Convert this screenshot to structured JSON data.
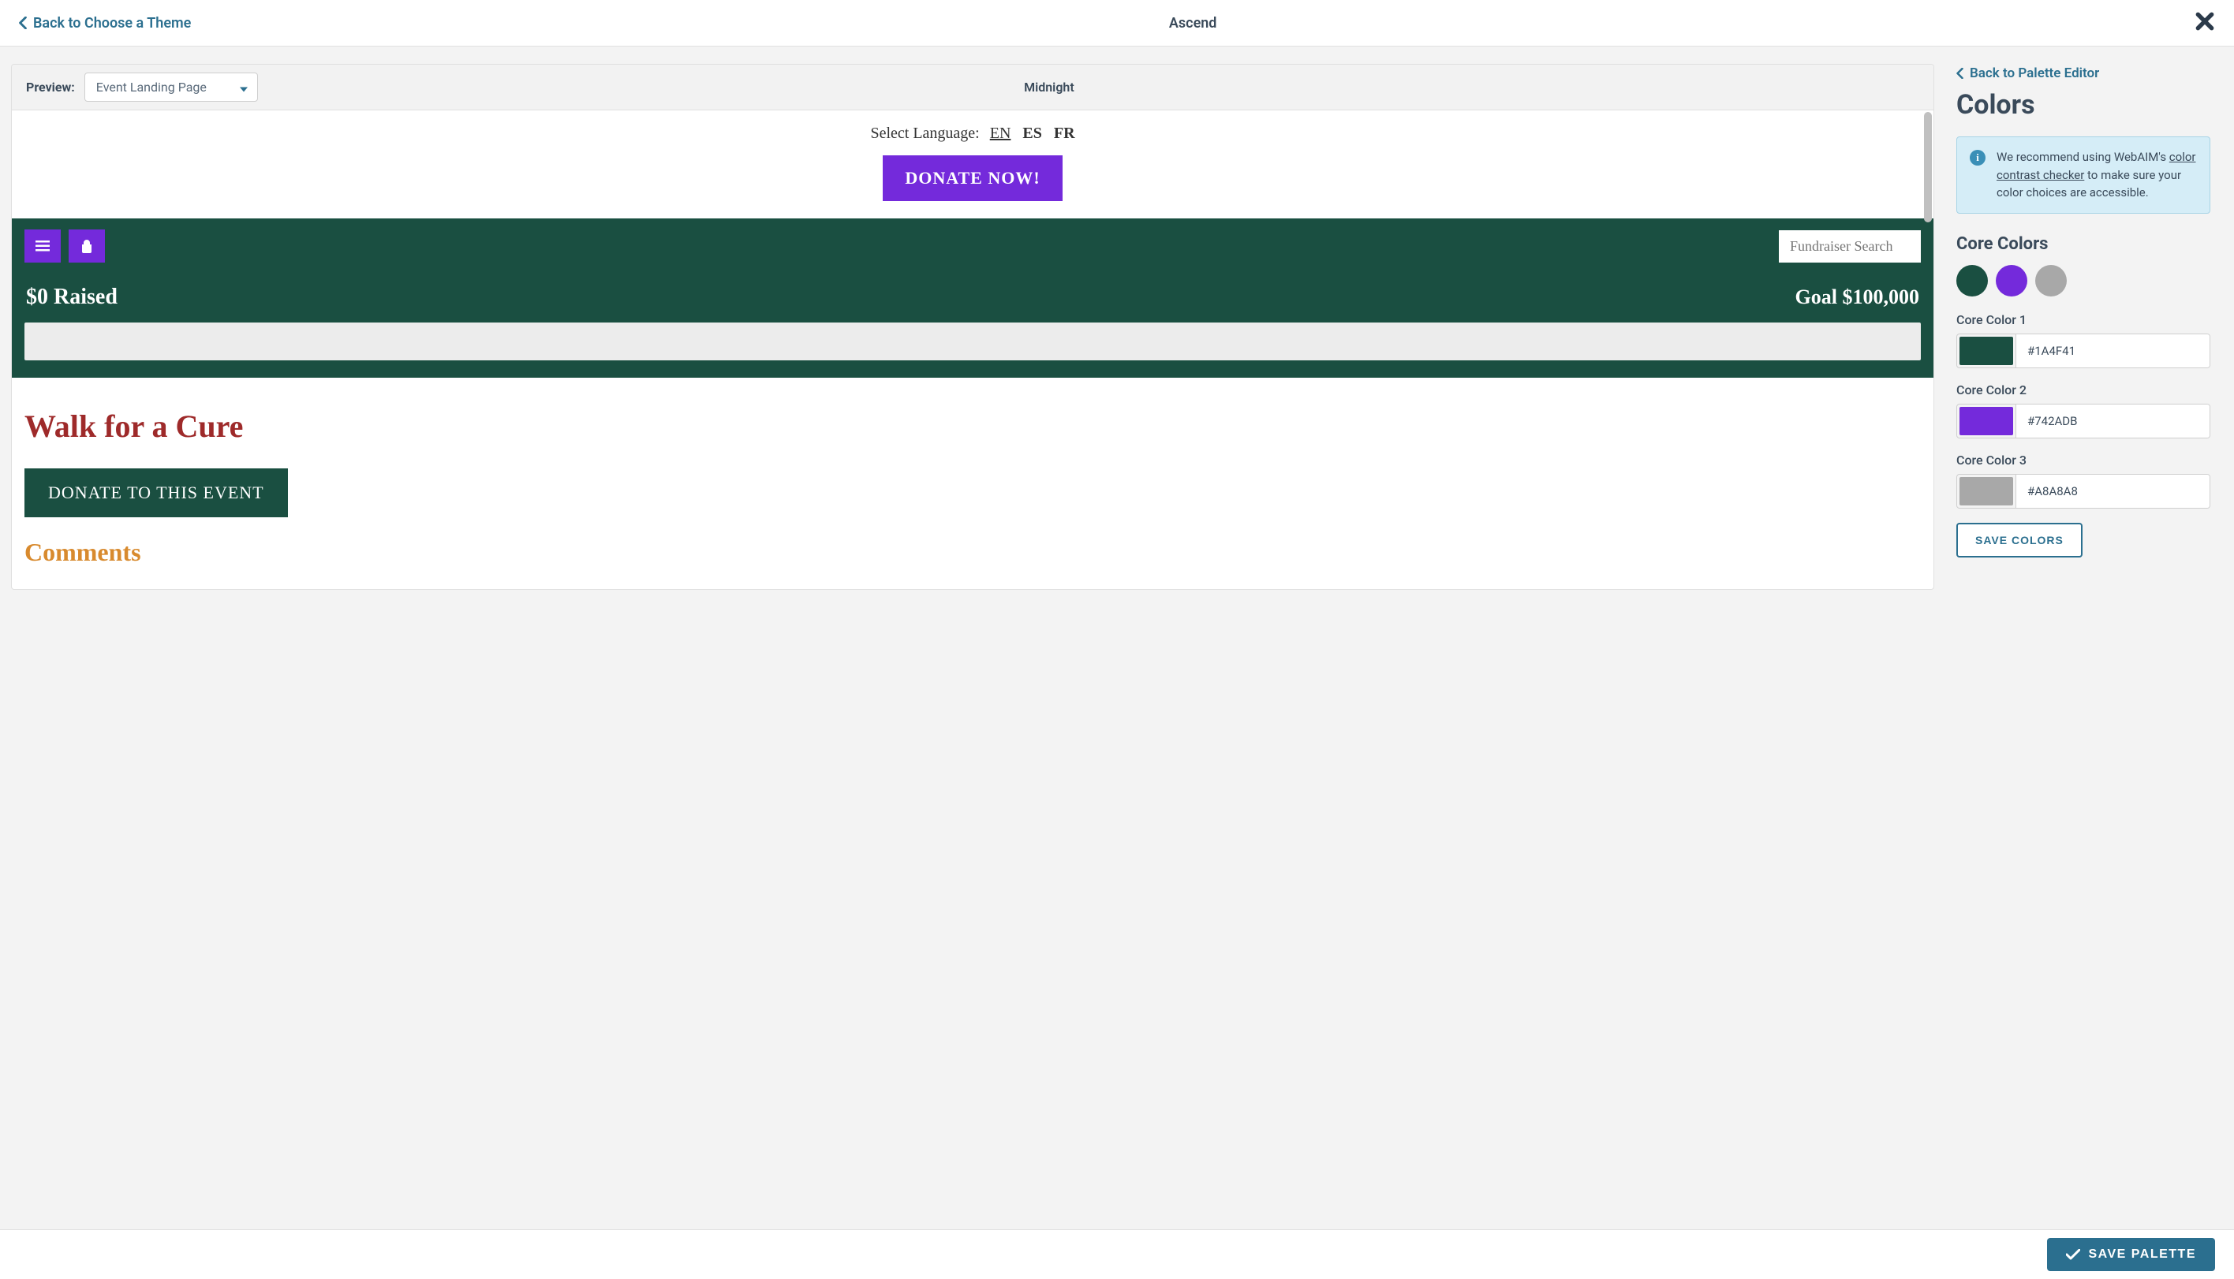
{
  "header": {
    "back_label": "Back to Choose a Theme",
    "title": "Ascend"
  },
  "preview": {
    "label": "Preview:",
    "selected": "Event Landing Page",
    "subtitle": "Midnight"
  },
  "page": {
    "lang_label": "Select Language:",
    "lang_en": "EN",
    "lang_es": "ES",
    "lang_fr": "FR",
    "donate_now": "DONATE NOW!",
    "search_placeholder": "Fundraiser Search",
    "raised": "$0 Raised",
    "goal": "Goal $100,000",
    "event_title": "Walk for a Cure",
    "donate_event": "DONATE TO THIS EVENT",
    "comments": "Comments"
  },
  "right": {
    "back_label": "Back to Palette Editor",
    "title": "Colors",
    "info_prefix": "We recommend using WebAIM's ",
    "info_link": "color contrast checker",
    "info_suffix": " to make sure your color choices are accessible.",
    "core_heading": "Core Colors",
    "colors": {
      "c1": {
        "label": "Core Color 1",
        "hex": "#1A4F41"
      },
      "c2": {
        "label": "Core Color 2",
        "hex": "#742ADB"
      },
      "c3": {
        "label": "Core Color 3",
        "hex": "#A8A8A8"
      }
    },
    "save_colors": "SAVE COLORS"
  },
  "footer": {
    "save_palette": "SAVE PALETTE"
  }
}
